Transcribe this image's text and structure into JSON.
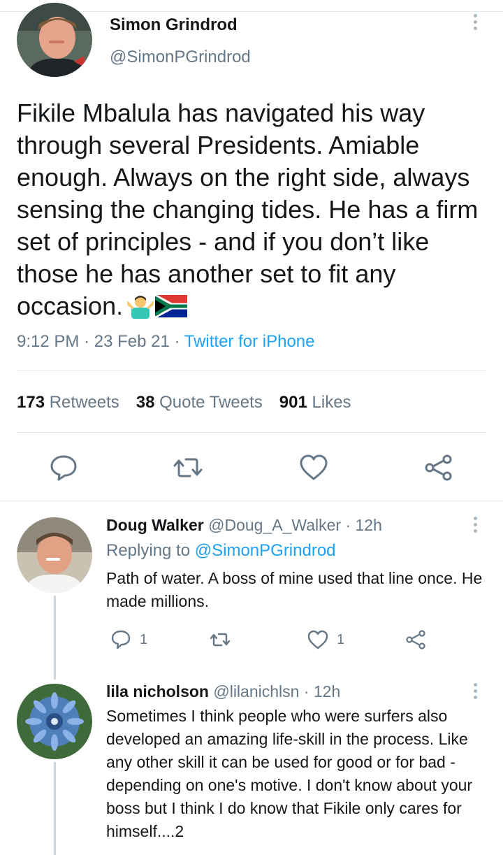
{
  "tweet": {
    "author_name": "Simon Grindrod",
    "author_handle": "@SimonPGrindrod",
    "text": "Fikile Mbalula has navigated his way through several Presidents. Amiable enough. Always on the right side, always sensing the changing tides. He has a firm set of principles - and if you don’t like those he has another set to fit any occasion.",
    "emojis": [
      "person-shrugging-emoji",
      "south-africa-flag-emoji"
    ],
    "time": "9:12 PM",
    "date": "23 Feb 21",
    "separator": "·",
    "source": "Twitter for iPhone",
    "stats": {
      "retweets_count": "173",
      "retweets_label": "Retweets",
      "quotes_count": "38",
      "quotes_label": "Quote Tweets",
      "likes_count": "901",
      "likes_label": "Likes"
    },
    "actions": [
      "reply-icon",
      "retweet-icon",
      "like-icon",
      "share-icon"
    ]
  },
  "replies": [
    {
      "name": "Doug Walker",
      "handle": "@Doug_A_Walker",
      "time": "· 12h",
      "replying_prefix": "Replying to",
      "replying_handle": "@SimonPGrindrod",
      "text": "Path of water. A boss of mine used that line once. He made millions.",
      "reply_count": "1",
      "like_count": "1"
    },
    {
      "name": "lila nicholson",
      "handle": "@lilanichlsn",
      "time": "· 12h",
      "text": "Sometimes I think people who were surfers also developed an amazing life-skill in the process. Like any other skill it can be used for good or for bad - depending on one's motive.  I don't know about your boss but I think I do know that Fikile only cares for himself....2"
    }
  ],
  "colors": {
    "accent": "#1da1f2",
    "secondary_text": "#657786",
    "primary_text": "#14171a",
    "divider": "#e1e8ed"
  }
}
